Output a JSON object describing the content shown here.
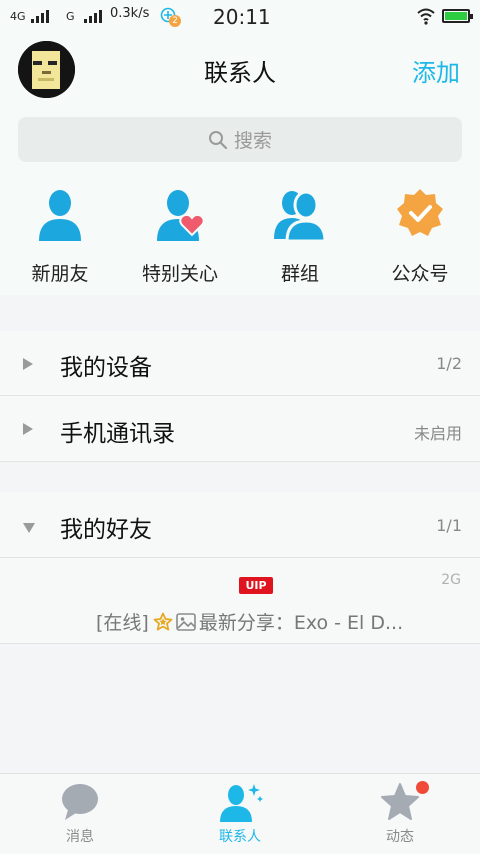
{
  "status_bar": {
    "net1": "4G",
    "net2": "G",
    "speed": "0.3k/s",
    "notif_count": "2",
    "time": "20:11"
  },
  "header": {
    "title": "联系人",
    "add_label": "添加"
  },
  "search": {
    "placeholder": "搜索"
  },
  "quick_actions": [
    {
      "label": "新朋友",
      "icon": "person-icon"
    },
    {
      "label": "特别关心",
      "icon": "person-heart-icon"
    },
    {
      "label": "群组",
      "icon": "group-icon"
    },
    {
      "label": "公众号",
      "icon": "verified-badge-icon"
    }
  ],
  "groups": [
    {
      "label": "我的设备",
      "meta": "1/2",
      "expanded": false
    },
    {
      "label": "手机通讯录",
      "meta": "未启用",
      "expanded": false
    },
    {
      "label": "我的好友",
      "meta": "1/1",
      "expanded": true
    }
  ],
  "friend": {
    "badge": "UIP",
    "network": "2G",
    "status": "[在线]",
    "share_text": "最新分享：Exo - El D..."
  },
  "tabs": [
    {
      "label": "消息",
      "icon": "chat-bubble-icon",
      "active": false
    },
    {
      "label": "联系人",
      "icon": "contacts-icon",
      "active": true
    },
    {
      "label": "动态",
      "icon": "star-icon",
      "active": false,
      "badge_dot": true
    }
  ],
  "colors": {
    "accent": "#1eb8e8",
    "vip_red": "#e0141e",
    "badge_orange": "#f5a442",
    "heart": "#ef5a6c"
  }
}
